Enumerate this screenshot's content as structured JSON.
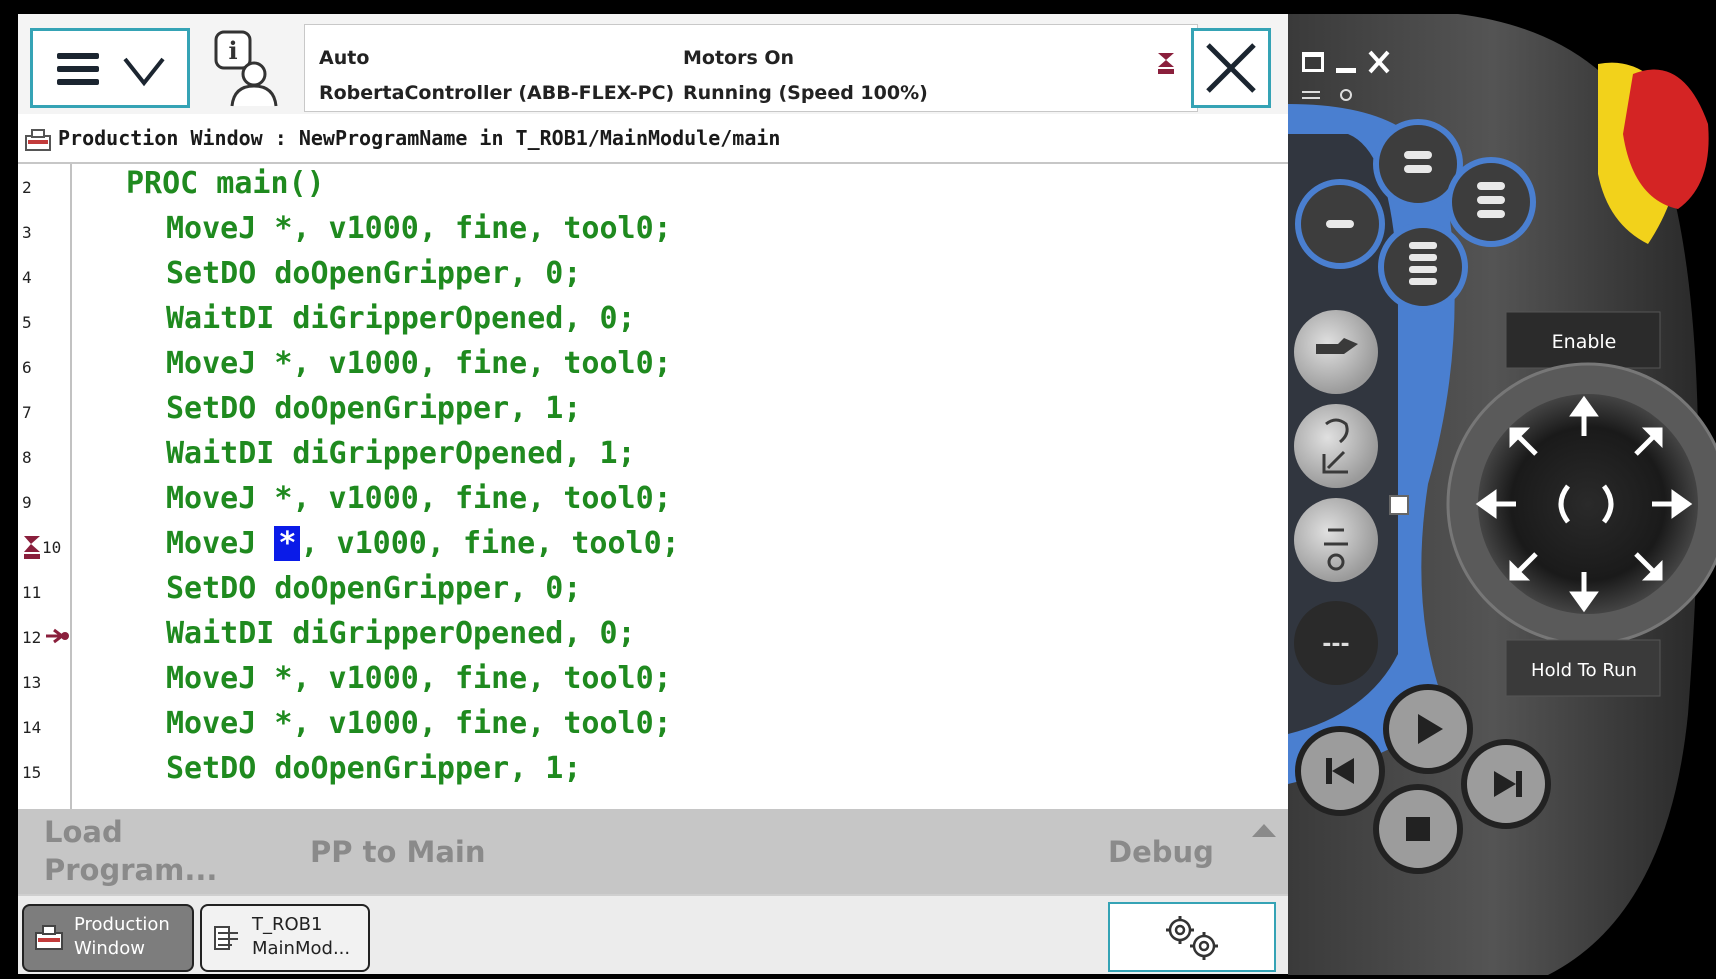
{
  "status_bar": {
    "mode": "Auto",
    "controller": "RobertaController (ABB-FLEX-PC)",
    "motors": "Motors On",
    "state": "Running (Speed 100%)"
  },
  "title_bar": {
    "text": "Production Window : NewProgramName in T_ROB1/MainModule/main"
  },
  "code": {
    "lines": [
      {
        "num": "2",
        "text": "PROC main()"
      },
      {
        "num": "3",
        "text": "MoveJ *, v1000, fine, tool0;"
      },
      {
        "num": "4",
        "text": "SetDO doOpenGripper, 0;"
      },
      {
        "num": "5",
        "text": "WaitDI diGripperOpened, 0;"
      },
      {
        "num": "6",
        "text": "MoveJ *, v1000, fine, tool0;"
      },
      {
        "num": "7",
        "text": "SetDO doOpenGripper, 1;"
      },
      {
        "num": "8",
        "text": "WaitDI diGripperOpened, 1;"
      },
      {
        "num": "9",
        "text": "MoveJ *, v1000, fine, tool0;"
      },
      {
        "num": "10",
        "text_before": "MoveJ ",
        "selected": "*",
        "text_after": ", v1000, fine, tool0;"
      },
      {
        "num": "11",
        "text": "SetDO doOpenGripper, 0;"
      },
      {
        "num": "12",
        "text": "WaitDI diGripperOpened, 0;"
      },
      {
        "num": "13",
        "text": "MoveJ *, v1000, fine, tool0;"
      },
      {
        "num": "14",
        "text": "MoveJ *, v1000, fine, tool0;"
      },
      {
        "num": "15",
        "text": "SetDO doOpenGripper, 1;"
      }
    ]
  },
  "command_bar": {
    "load_program_line1": "Load",
    "load_program_line2": "Program...",
    "pp_to_main": "PP to Main",
    "debug": "Debug"
  },
  "taskbar": {
    "production_line1": "Production",
    "production_line2": "Window",
    "rob_line1": "T_ROB1",
    "rob_line2": "MainMod..."
  },
  "device": {
    "enable": "Enable",
    "hold_to_run": "Hold To Run",
    "dash_button": "---"
  },
  "colors": {
    "accent": "#35a3b5",
    "code_green": "#1f8a1f",
    "selection_blue": "#0a1be8",
    "device_blue": "#4a7fd0",
    "estop_red": "#d42424",
    "estop_yellow": "#f2d21b"
  }
}
